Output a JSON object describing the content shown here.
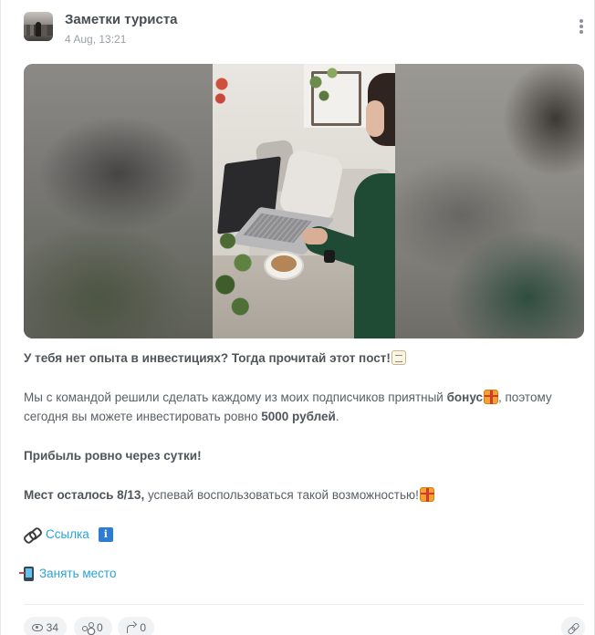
{
  "post": {
    "channel_name": "Заметки туриста",
    "date": "4 Aug, 13:21"
  },
  "body": {
    "headline": "У тебя нет опыта в инвестициях? Тогда прочитай этот пост!",
    "p2_part1": "Мы с командой решили сделать каждому из моих подписчиков приятный ",
    "p2_bold1": "бонус",
    "p2_part2": ", поэтому сегодня вы можете инвестировать ровно ",
    "p2_bold2": "5000 рублей",
    "p2_part3": ".",
    "p3": "Прибыль ровно через сутки!",
    "p4_bold": "Мест осталось 8/13,",
    "p4_rest": " успевай воспользоваться такой возможностью!",
    "link_label": "Ссылка",
    "cta_label": "Занять место"
  },
  "icons": {
    "headline_emoji": "memo-icon",
    "bonus_emoji": "gift-icon",
    "link_emoji": "chain-link-icon",
    "info_emoji": "info-icon",
    "cta_emoji": "phone-arrow-icon"
  },
  "stats": {
    "views": "34",
    "shares": "0",
    "reposts": "0"
  },
  "colors": {
    "link": "#2aa3d6",
    "text": "#5a6066"
  }
}
